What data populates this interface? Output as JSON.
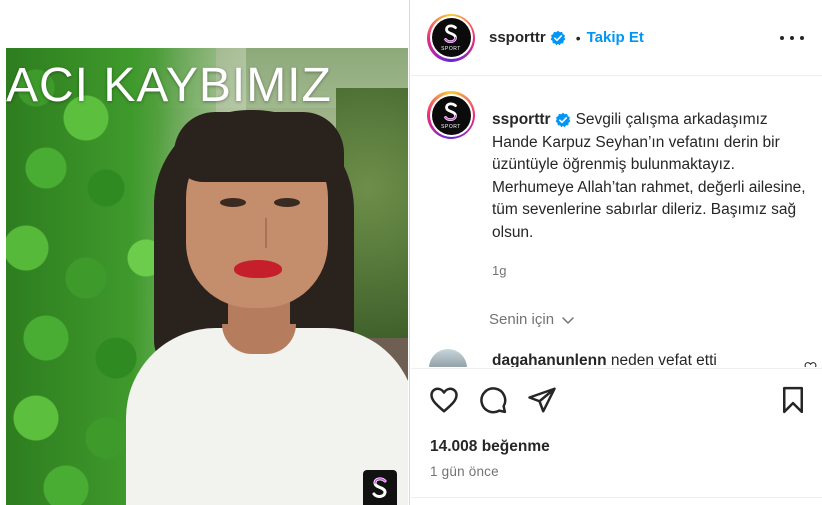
{
  "image_panel": {
    "headline": "ACI KAYBIMIZ"
  },
  "header": {
    "username": "ssporttr",
    "separator": "•",
    "follow_label": "Takip Et",
    "avatar_subtext": "SPORT"
  },
  "caption": {
    "username": "ssporttr",
    "text": "Sevgili çalışma arkadaşımız Hande Karpuz Seyhan’ın vefatını derin bir üzüntüyle öğrenmiş bulunmaktayız. Merhumeye Allah’tan rahmet, değerli ailesine, tüm sevenlerine sabırlar dileriz. Başımız sağ olsun.",
    "time": "1g"
  },
  "for_you": {
    "label": "Senin için"
  },
  "comments": [
    {
      "username": "dagahanunlenn",
      "text": "neden vefat etti"
    }
  ],
  "stats": {
    "likes": "14.008 beğenme",
    "posted": "1 gün önce"
  },
  "icons": {
    "verified": "verified-badge-icon",
    "more": "more-options-icon",
    "like": "heart-icon",
    "comment": "comment-icon",
    "share": "paper-plane-icon",
    "save": "bookmark-icon",
    "chevron": "chevron-down-icon"
  },
  "colors": {
    "accent": "#0095f6",
    "text": "#262626",
    "muted": "#737373",
    "verified": "#0095f6"
  }
}
